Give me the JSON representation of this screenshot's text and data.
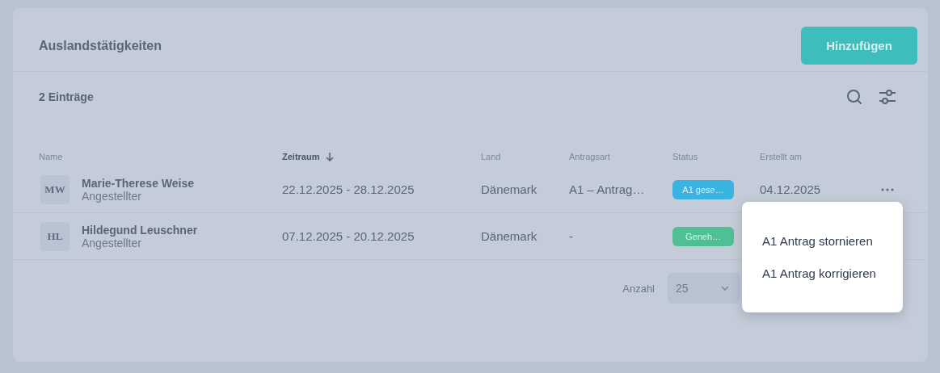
{
  "page": {
    "title": "Auslandstätigkeiten",
    "add_button": "Hinzufügen",
    "count": "2 Einträge"
  },
  "table": {
    "columns": [
      {
        "label": "Name",
        "sorted": false
      },
      {
        "label": "Zeitraum",
        "sorted": true
      },
      {
        "label": "Land",
        "sorted": false
      },
      {
        "label": "Antragsart",
        "sorted": false
      },
      {
        "label": "Status",
        "sorted": false
      },
      {
        "label": "Erstellt am",
        "sorted": false
      }
    ],
    "rows": [
      {
        "initials": "MW",
        "name": "Marie-Therese Weise",
        "role": "Angestellter",
        "period": "22.12.2025 - 28.12.2025",
        "country": "Dänemark",
        "type": "A1 – Antrag…",
        "status": "A1 gese…",
        "color": "#3bb3e0",
        "created": "04.12.2025",
        "menu_open": true
      },
      {
        "initials": "HL",
        "name": "Hildegund Leuschner",
        "role": "Angestellter",
        "period": "07.12.2025 - 20.12.2025",
        "country": "Dänemark",
        "type": "-",
        "status": "Geneh…",
        "color": "#4fbf95",
        "created": "",
        "menu_open": false
      }
    ]
  },
  "pagination": {
    "label": "Anzahl",
    "value": "25"
  },
  "context_menu": {
    "items": [
      "A1 Antrag stornieren",
      "A1 Antrag korrigieren"
    ]
  }
}
